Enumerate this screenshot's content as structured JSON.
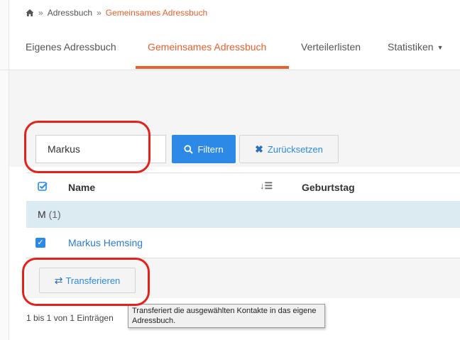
{
  "breadcrumb": {
    "separator": "»",
    "items": [
      "Adressbuch",
      "Gemeinsames Adressbuch"
    ]
  },
  "tabs": {
    "own": "Eigenes Adressbuch",
    "shared": "Gemeinsames Adressbuch",
    "lists": "Verteilerlisten",
    "stats": "Statistiken",
    "active": "shared"
  },
  "filter": {
    "search_value": "Markus",
    "filter_label": "Filtern",
    "reset_label": "Zurücksetzen"
  },
  "table": {
    "columns": {
      "name": "Name",
      "birthday": "Geburtstag"
    },
    "group": {
      "letter": "M",
      "count": "(1)"
    },
    "rows": [
      {
        "name": "Markus Hemsing",
        "checked": true
      }
    ]
  },
  "actions": {
    "transfer_label": "Transferieren"
  },
  "footer": {
    "entries": "1 bis 1 von 1 Einträgen"
  },
  "tooltip": {
    "text": "Transferiert die ausgewählten Kontakte in das eigene Adressbuch."
  },
  "colors": {
    "accent_orange": "#e8602c",
    "primary_blue": "#2c8ae6",
    "group_row_bg": "#dceaf2",
    "annotation_red": "#e3231b"
  },
  "icons": {
    "home": "home-icon",
    "search": "search-icon",
    "reset": "x-icon",
    "sort": "sort-icon",
    "select_all": "check-square-icon",
    "transfer": "transfer-icon"
  }
}
